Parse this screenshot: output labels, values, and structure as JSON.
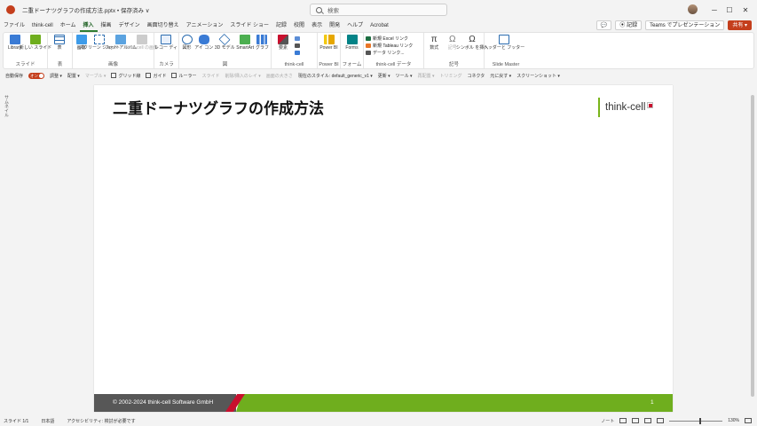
{
  "window": {
    "doc_title": "二重ドーナツグラフの作成方法.pptx • 保存済み ∨",
    "search_placeholder": "検索",
    "minimize": "─",
    "maximize": "☐",
    "close": "✕"
  },
  "menu": {
    "tabs": [
      "ファイル",
      "think-cell",
      "ホーム",
      "挿入",
      "描画",
      "デザイン",
      "画面切り替え",
      "アニメーション",
      "スライド ショー",
      "記録",
      "校閲",
      "表示",
      "開発",
      "ヘルプ",
      "Acrobat"
    ],
    "active_index": 3,
    "comment": "💬",
    "record": "⦿ 記録",
    "teams": "Teams でプレゼンテーション",
    "share": "共有 ▾"
  },
  "ribbon": {
    "groups": [
      {
        "label": "スライド",
        "buttons": [
          "Library",
          "新しい スライド"
        ]
      },
      {
        "label": "表",
        "buttons": [
          "表"
        ]
      },
      {
        "label": "画像",
        "buttons": [
          "画像",
          "スクリーン ショット",
          "フォト アルバム",
          "think-cell の画像"
        ]
      },
      {
        "label": "カメラ",
        "buttons": [
          "レコー ディ"
        ]
      },
      {
        "label": "図",
        "buttons": [
          "図形",
          "アイ コン",
          "3D モデル",
          "SmartArt",
          "グラフ"
        ]
      },
      {
        "label": "think-cell",
        "buttons": [
          "要素"
        ]
      },
      {
        "label": "Power BI",
        "buttons": [
          "Power BI"
        ]
      },
      {
        "label": "フォーム",
        "buttons": [
          "Forms"
        ]
      },
      {
        "label": "think-cell データ",
        "items": [
          "新規 Excel リンク",
          "新規 Tableau リンク",
          "データ リンク..."
        ]
      },
      {
        "label": "記号",
        "buttons": [
          "数式",
          "記号",
          "シンボル を挿入"
        ]
      },
      {
        "label": "Slide Master",
        "buttons": [
          "ヘッダーと フッター"
        ]
      }
    ]
  },
  "qat": {
    "autosave": "自動保存",
    "toggle": "オン",
    "items": [
      "調整 ▾",
      "配置 ▾",
      "マーブル ▾",
      "グリッド線",
      "ガイド",
      "ルーラー",
      "スライド",
      "削除/挿入のレイ ▾",
      "画面の大きさ",
      "現在のスタイル: default_generic_v1 ▾",
      "更新 ▾",
      "ツール ▾",
      "再配置 ▾",
      "トリミング",
      "コネクタ",
      "元に戻す ▾",
      "スクリーンショット ▾"
    ]
  },
  "left_panel": {
    "label": "サムネイル"
  },
  "slide": {
    "title": "二重ドーナツグラフの作成方法",
    "logo_text": "think-cell",
    "copyright": "© 2002-2024 think-cell Software GmbH",
    "page_number": "1"
  },
  "status": {
    "slide_info": "スライド 1/1",
    "language": "日本語",
    "accessibility": "アクセシビリティ: 検討が必要です",
    "notes": "ノート",
    "zoom": "130%"
  },
  "colors": {
    "accent_green": "#6fae1e",
    "footer_dark": "#575757",
    "brand_red": "#c8102e",
    "ppt_orange": "#c43e1c"
  }
}
